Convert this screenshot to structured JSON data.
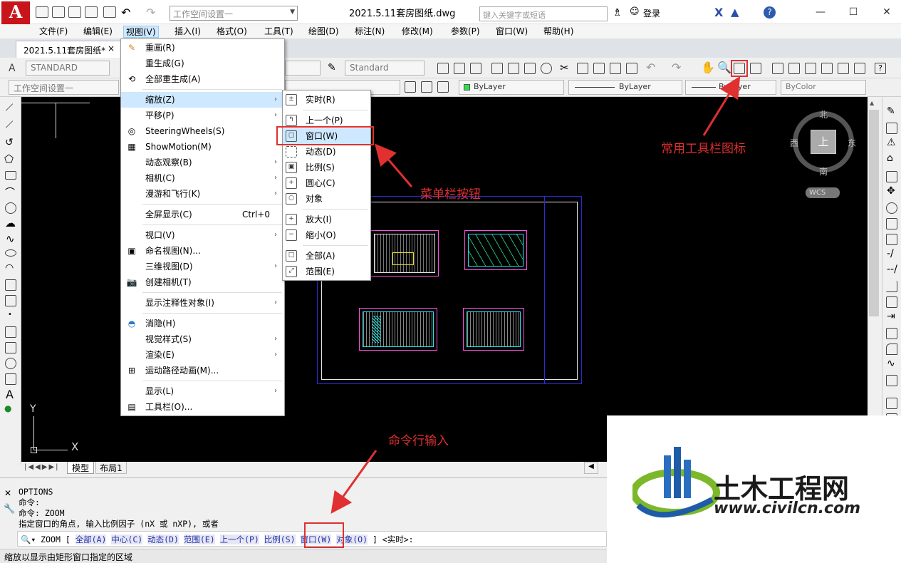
{
  "app": {
    "logo_letter": "A",
    "document_title": "2021.5.11套房图纸.dwg",
    "workspace": "工作空间设置一",
    "search_placeholder": "键入关键字或短语",
    "login": "登录",
    "help": "?"
  },
  "window": {
    "minimize": "—",
    "maximize": "☐",
    "close": "✕"
  },
  "menus": [
    "文件(F)",
    "编辑(E)",
    "视图(V)",
    "插入(I)",
    "格式(O)",
    "工具(T)",
    "绘图(D)",
    "标注(N)",
    "修改(M)",
    "参数(P)",
    "窗口(W)",
    "帮助(H)"
  ],
  "doc_tab": {
    "name": "2021.5.11套房图纸*",
    "close": "×"
  },
  "toolbar": {
    "text_style": "STANDARD",
    "dim_style": "Standard",
    "workspace2": "工作空间设置一",
    "layer_color": "ByLayer",
    "linetype": "ByLayer",
    "lineweight": "ByLayer",
    "plot_style": "ByColor"
  },
  "view_menu": {
    "items": [
      {
        "label": "重画(R)",
        "icon": "pencil-icon"
      },
      {
        "label": "重生成(G)"
      },
      {
        "label": "全部重生成(A)",
        "icon": "regen-icon"
      },
      {
        "label": "缩放(Z)",
        "submenu": "true"
      },
      {
        "label": "平移(P)",
        "submenu": "true"
      },
      {
        "label": "SteeringWheels(S)",
        "icon": "wheel-icon"
      },
      {
        "label": "ShowMotion(M)",
        "icon": "showmotion-icon"
      },
      {
        "label": "动态观察(B)",
        "submenu": "true"
      },
      {
        "label": "相机(C)",
        "submenu": "true"
      },
      {
        "label": "漫游和飞行(K)",
        "submenu": "true"
      },
      {
        "label": "全屏显示(C)",
        "shortcut": "Ctrl+0"
      },
      {
        "label": "视口(V)",
        "submenu": "true"
      },
      {
        "label": "命名视图(N)...",
        "icon": "named-view-icon"
      },
      {
        "label": "三维视图(D)",
        "submenu": "true"
      },
      {
        "label": "创建相机(T)",
        "icon": "camera-icon"
      },
      {
        "label": "显示注释性对象(I)",
        "submenu": "true"
      },
      {
        "label": "消隐(H)",
        "icon": "hide-icon"
      },
      {
        "label": "视觉样式(S)",
        "submenu": "true"
      },
      {
        "label": "渲染(E)",
        "submenu": "true"
      },
      {
        "label": "运动路径动画(M)...",
        "icon": "motion-path-icon"
      },
      {
        "label": "显示(L)",
        "submenu": "true"
      },
      {
        "label": "工具栏(O)...",
        "icon": "toolbar-icon"
      }
    ]
  },
  "zoom_submenu": [
    "实时(R)",
    "上一个(P)",
    "窗口(W)",
    "动态(D)",
    "比例(S)",
    "圆心(C)",
    "对象",
    "放大(I)",
    "缩小(O)",
    "全部(A)",
    "范围(E)"
  ],
  "viewcube": {
    "north": "北",
    "south": "南",
    "east": "东",
    "west": "西",
    "top": "上",
    "wcs": "WCS"
  },
  "ucs": {
    "y": "Y",
    "x": "X"
  },
  "layout_tabs": [
    "模型",
    "布局1"
  ],
  "command_history": [
    "OPTIONS",
    "命令:",
    "命令: ZOOM",
    "指定窗口的角点, 输入比例因子 (nX 或 nXP), 或者"
  ],
  "command_line": {
    "cmd": "ZOOM",
    "open": "[",
    "options": [
      "全部(A)",
      "中心(C)",
      "动态(D)",
      "范围(E)",
      "上一个(P)",
      "比例(S)",
      "窗口(W)",
      "对象(O)"
    ],
    "close": "] <实时>:"
  },
  "status": "缩放以显示由矩形窗口指定的区域",
  "annotations": {
    "toolbar_icon": "常用工具栏图标",
    "menu_button": "菜单栏按钮",
    "command_input": "命令行输入"
  },
  "watermark": {
    "brand": "土木工程网",
    "url": "www.civilcn.com"
  },
  "colors": {
    "accent_red": "#e03030",
    "highlight": "#cde8ff",
    "canvas": "#000000",
    "logo_red": "#c8141b"
  }
}
